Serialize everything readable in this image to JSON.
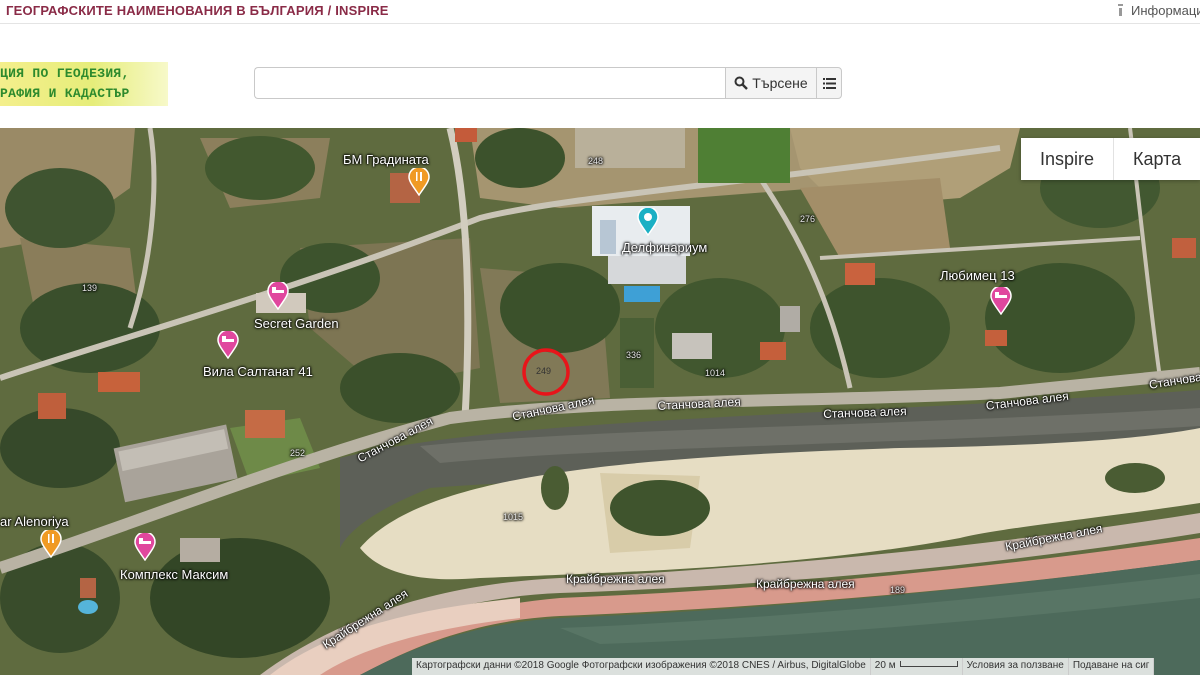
{
  "topbar": {
    "title": "ГЕОГРАФСКИТЕ НАИМЕНОВАНИЯ В БЪЛГАРИЯ / INSPIRE",
    "info_link": "Информаци"
  },
  "logo": {
    "line1": "ЦИЯ ПО ГЕОДЕЗИЯ,",
    "line2": "РАФИЯ И КАДАСТЪР"
  },
  "search": {
    "value": "",
    "placeholder": "",
    "button_label": "Търсене",
    "search_icon": "search-icon",
    "list_icon": "list-icon"
  },
  "map": {
    "toggle": {
      "inspire": "Inspire",
      "map": "Карта"
    },
    "places": {
      "bm_gradinata": "БМ Градината",
      "delfinarium": "Делфинариум",
      "lyubimets": "Любимец 13",
      "secret_garden": "Secret Garden",
      "vila_saltanat": "Вила Салтанат 41",
      "alenoriya": "ar Alenoriya",
      "kompleks_maksim": "Комплекс Максим"
    },
    "streets": {
      "stanchova_1": "Станчова алея",
      "stanchova_2": "Станчова алея",
      "stanchova_3": "Станчова алея",
      "stanchova_4": "Станчова алея",
      "stanchova_5": "Станчова алея",
      "stanchova_6": "Станчова але",
      "kraybrezhna_1": "Крайбрежна алея",
      "kraybrezhna_2": "Крайбрежна алея",
      "kraybrezhna_3": "Крайбрежна алея",
      "kraybrezhna_4": "Крайбрежна алея"
    },
    "parcels": {
      "p249": "249",
      "p139": "139",
      "p248": "248",
      "p276": "276",
      "p1015": "1015",
      "p189": "189",
      "p336": "336",
      "p1014": "1014",
      "p252": "252"
    },
    "highlight_marker": {
      "label": "249",
      "color": "#e8141a"
    },
    "pin_colors": {
      "lodging": "#e0479e",
      "food": "#f09a24",
      "attraction": "#1bb0c4"
    },
    "attribution": {
      "data": "Картографски данни ©2018 Google Фотографски изображения ©2018 CNES / Airbus, DigitalGlobe",
      "scale": "20 м",
      "terms": "Условия за ползване",
      "report": "Подаване на сиг"
    }
  }
}
